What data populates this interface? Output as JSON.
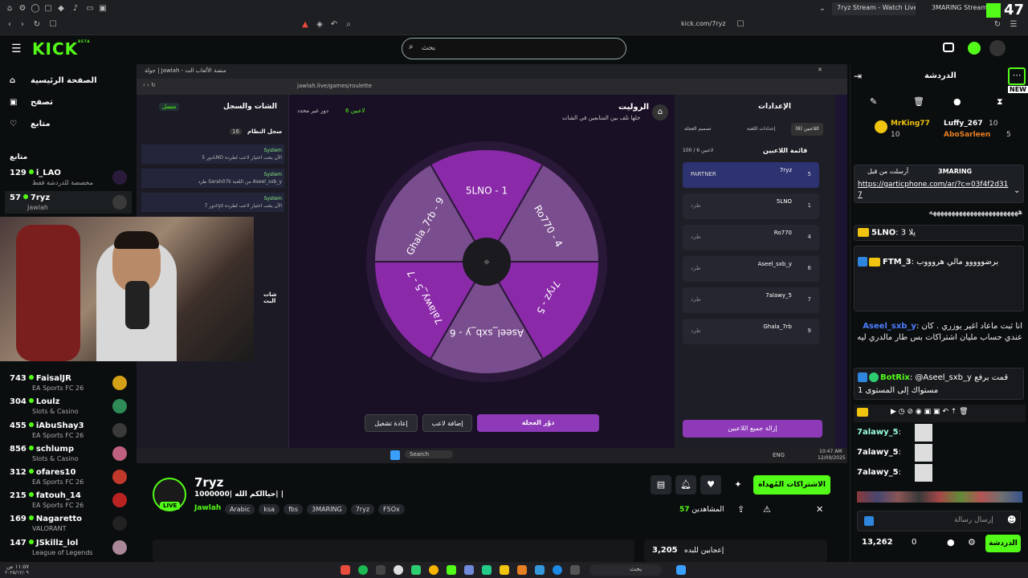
{
  "browser": {
    "tabs": [
      "7ryz Stream - Watch Live on Kick",
      "3MARING Stream - Watc"
    ],
    "url": "kick.com/7ryz",
    "counter": "47"
  },
  "header": {
    "logo": "KICK",
    "logo_sup": "BETA",
    "search_placeholder": "بحث"
  },
  "sidebar": {
    "nav": [
      {
        "label": "الصفحة الرئيسية",
        "icon": "home-icon"
      },
      {
        "label": "تصفح",
        "icon": "browse-icon"
      },
      {
        "label": "متابع",
        "icon": "heart-icon"
      }
    ],
    "following_title": "متابع",
    "channels_top": [
      {
        "count": "129",
        "name": "i_LAO",
        "sub": "مخصصة للدردشة فقط"
      },
      {
        "count": "57",
        "name": "7ryz",
        "sub": "Jawlah"
      }
    ],
    "channels": [
      {
        "count": "743",
        "name": "FaisalJR",
        "sub": "EA Sports FC 26"
      },
      {
        "count": "304",
        "name": "Loulz",
        "sub": "Slots & Casino"
      },
      {
        "count": "455",
        "name": "iAbuShay3",
        "sub": "EA Sports FC 26"
      },
      {
        "count": "856",
        "name": "schlump",
        "sub": "Slots & Casino"
      },
      {
        "count": "312",
        "name": "ofares10",
        "sub": "EA Sports FC 26"
      },
      {
        "count": "215",
        "name": "fatouh_14",
        "sub": "EA Sports FC 26"
      },
      {
        "count": "169",
        "name": "Nagaretto",
        "sub": "VALORANT"
      },
      {
        "count": "147",
        "name": "JSkillz_lol",
        "sub": "League of Legends"
      }
    ]
  },
  "game": {
    "window_title": "جولة | Jawlah - منصة الألعاب الت",
    "address": "jawlah.live/games/roulette",
    "chat_title": "الشات والسجل",
    "connected": "متصل",
    "system_log": "سجل النظام",
    "log_count": "16",
    "chat_section": "شات البث",
    "log_entries": [
      {
        "time": "AM 10:46",
        "who": "System",
        "text": "دور 5LNO الآن يجب اختيار لاعب لطرده"
      },
      {
        "time": "AM 10:46",
        "who": "System",
        "text": "طرد Sarah07k من اللعبة Aseel_sxb_y"
      },
      {
        "time": "AM 10:47",
        "who": "System",
        "text": "دور 7ryz الآن يجب اختيار لاعب لطرده"
      }
    ],
    "game_title": "الروليت",
    "game_subtitle": "خلها تلف بين المتابعين في الشات",
    "players_count_label": "6 لاعبين",
    "round_label": "دور غير محدد",
    "wheel_segments": [
      "5LNO - 1",
      "Ro770 - 4",
      "7ryz - 5",
      "Aseel_sxb_y - 6",
      "7alawy_5 - 7",
      "Ghala_7rb - 9"
    ],
    "btn_spin": "دوّر العجلة",
    "btn_add": "إضافة لاعب",
    "btn_restart": "إعادة تشغيل",
    "settings_title": "الإعدادات",
    "settings_tabs": [
      "اللاعبين (6)",
      "إعدادات اللعبة",
      "تصميم العجلة"
    ],
    "player_list_title": "قائمة اللاعبين",
    "player_limit": "100 / 6 لاعبين",
    "players": [
      {
        "name": "7ryz",
        "num": "5",
        "kick": "PARTNER"
      },
      {
        "name": "5LNO",
        "num": "1",
        "kick": "طرد"
      },
      {
        "name": "Ro770",
        "num": "4",
        "kick": "طرد"
      },
      {
        "name": "Aseel_sxb_y",
        "num": "6",
        "kick": "طرد"
      },
      {
        "name": "7alawy_5",
        "num": "7",
        "kick": "طرد"
      },
      {
        "name": "Ghala_7rb",
        "num": "9",
        "kick": "طرد"
      }
    ],
    "remove_all": "إزالة جميع اللاعبين",
    "taskbar_search": "Search",
    "clock": "10:47 AM",
    "date": "12/09/2025",
    "lang": "ENG"
  },
  "stream": {
    "name": "7ryz",
    "title": "حياالكم الله |1000000| |",
    "category": "Jawlah",
    "live": "LIVE",
    "tags": [
      "Arabic",
      "ksa",
      "fbs",
      "3MARING",
      "7ryz",
      "F5Ox"
    ],
    "viewers_label": "المشاهدين",
    "viewers": "57",
    "subscribe_label": "الاشتراكات المُهداة",
    "subs_count": "3,205",
    "subs_label": "إعجابين للبده"
  },
  "chat": {
    "title": "الدردشة",
    "new_badge": "NEW",
    "top_gifters": [
      {
        "name": "MrKing77",
        "count": "10"
      },
      {
        "name": "Luffy_267",
        "count": "10"
      },
      {
        "name": "AboSarleen",
        "count": "5"
      }
    ],
    "pinned_by": "3MARING",
    "pinned_label": "أرسلت من قبل",
    "pinned_link": "https://garticphone.com/ar/?c=03f4f2d317",
    "messages": [
      {
        "user": "",
        "text": "ههههههههههههههههههههههههه"
      },
      {
        "user": "5LNO",
        "text": "يلا 3"
      },
      {
        "user": "FTM_3",
        "text": "برضووووو مالي هروووب"
      },
      {
        "user": "Aseel_sxb_y",
        "text": "انا ثبت ماعاد اغير يوزري . كان عندي حساب مليان اشتراكات بس طار مالدري ليه"
      },
      {
        "user": "BotRix",
        "text": "@Aseel_sxb_y قمت برفع مستواك إلى المستوى 1"
      },
      {
        "user": "7alawy_5",
        "text": ""
      },
      {
        "user": "7alawy_5",
        "text": ""
      },
      {
        "user": "7alawy_5",
        "text": ""
      }
    ],
    "input_placeholder": "إرسال رسالة",
    "points": "13,262",
    "zero": "0",
    "send": "الدردشة"
  },
  "os": {
    "search": "بحث",
    "time": "١١:٥٧ ص",
    "date": "٢٠٢٥/١٢/٠٩"
  }
}
